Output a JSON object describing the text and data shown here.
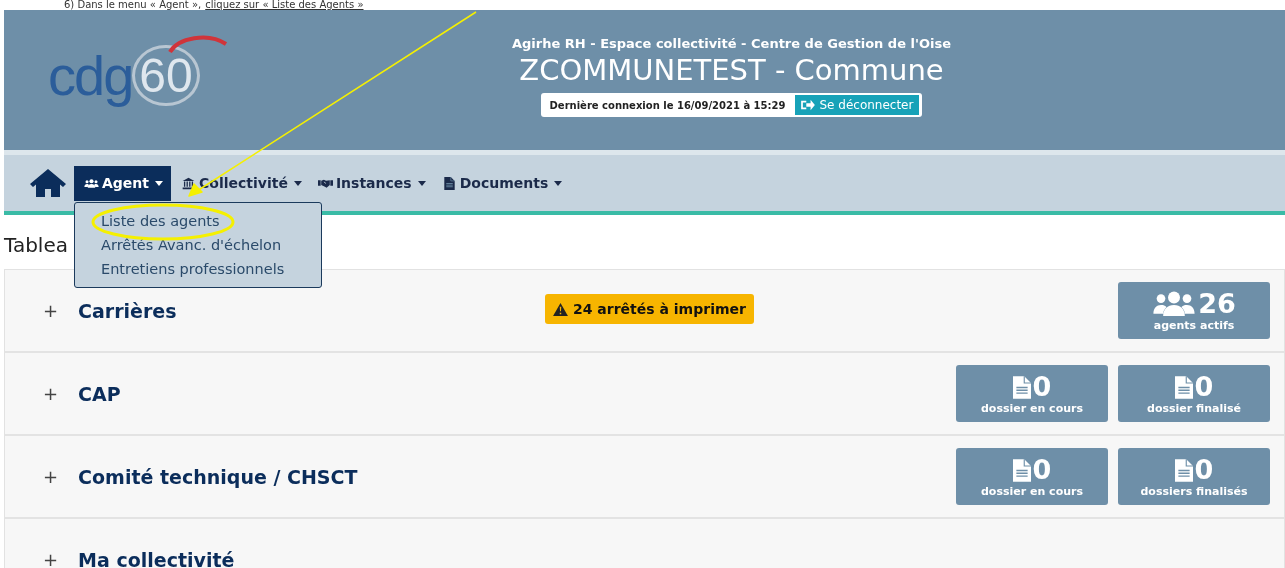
{
  "instruction": {
    "text": "6) Dans le menu « Agent »,",
    "link": "cliquez sur « Liste des Agents »"
  },
  "header": {
    "logo": {
      "letters": "cdg",
      "number": "60"
    },
    "subtitle": "Agirhe RH - Espace collectivité - Centre de Gestion de l'Oise",
    "title": "ZCOMMUNETEST - Commune",
    "last_login": "Dernière connexion le 16/09/2021 à 15:29",
    "logout": "Se déconnecter"
  },
  "nav": [
    {
      "kind": "home"
    },
    {
      "kind": "menu",
      "label": "Agent",
      "selected": true,
      "expanded": true,
      "menu_items": [
        "Liste des agents",
        "Arrêtés Avanc. d'échelon",
        "Entretiens professionnels"
      ]
    },
    {
      "kind": "menu",
      "label": "Collectivité",
      "selected": false,
      "expanded": false
    },
    {
      "kind": "menu",
      "label": "Instances",
      "selected": false,
      "expanded": false
    },
    {
      "kind": "menu",
      "label": "Documents",
      "selected": false,
      "expanded": false
    }
  ],
  "page_title": "Tablea",
  "sections": [
    {
      "toggle": "+",
      "title": "Carrières",
      "alert": "24 arrêtés à imprimer",
      "stats": [
        {
          "kind": "agents",
          "value": "26",
          "label": "agents actifs"
        }
      ]
    },
    {
      "toggle": "+",
      "title": "CAP",
      "stats": [
        {
          "kind": "dossier",
          "value": "0",
          "label": "dossier en cours"
        },
        {
          "kind": "dossier",
          "value": "0",
          "label": "dossier finalisé"
        }
      ]
    },
    {
      "toggle": "+",
      "title": "Comité technique / CHSCT",
      "stats": [
        {
          "kind": "dossier",
          "value": "0",
          "label": "dossier en cours"
        },
        {
          "kind": "dossier",
          "value": "0",
          "label": "dossiers finalisés"
        }
      ]
    },
    {
      "toggle": "+",
      "title": "Ma collectivité"
    }
  ]
}
